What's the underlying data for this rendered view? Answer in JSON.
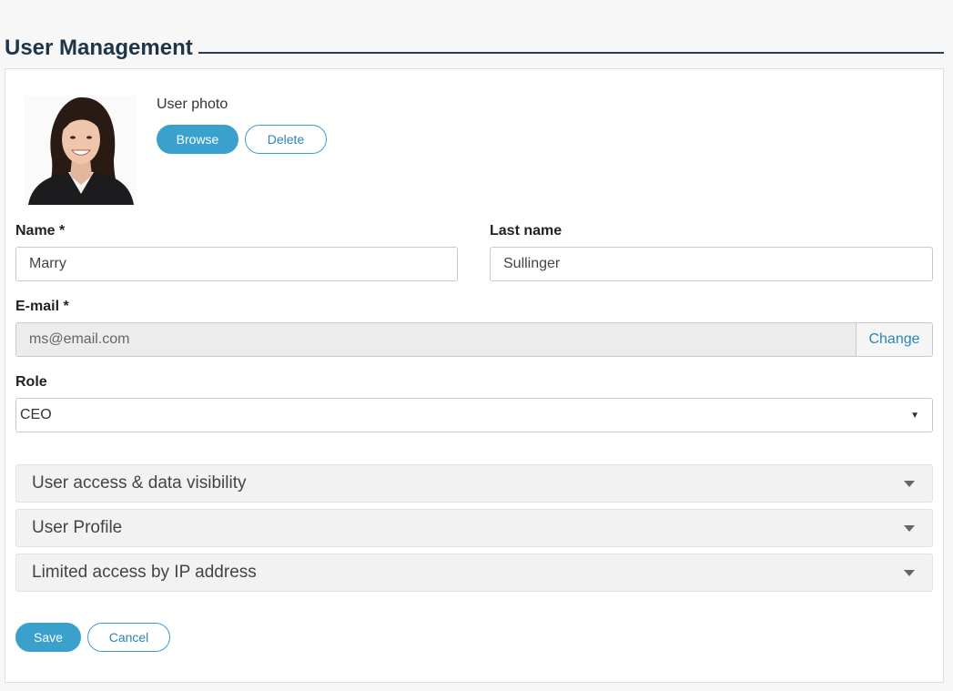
{
  "page": {
    "title": "User Management"
  },
  "photo": {
    "caption": "User photo",
    "browse_label": "Browse",
    "delete_label": "Delete"
  },
  "form": {
    "name_label": "Name *",
    "name_value": "Marry",
    "last_name_label": "Last name",
    "last_name_value": "Sullinger",
    "email_label": "E-mail *",
    "email_value": "ms@email.com",
    "email_change_label": "Change",
    "role_label": "Role",
    "role_value": "CEO"
  },
  "sections": [
    {
      "label": "User access & data visibility"
    },
    {
      "label": "User Profile"
    },
    {
      "label": "Limited access by IP address"
    }
  ],
  "actions": {
    "save_label": "Save",
    "cancel_label": "Cancel"
  },
  "colors": {
    "accent": "#3aa0cc",
    "title": "#1e3549"
  }
}
